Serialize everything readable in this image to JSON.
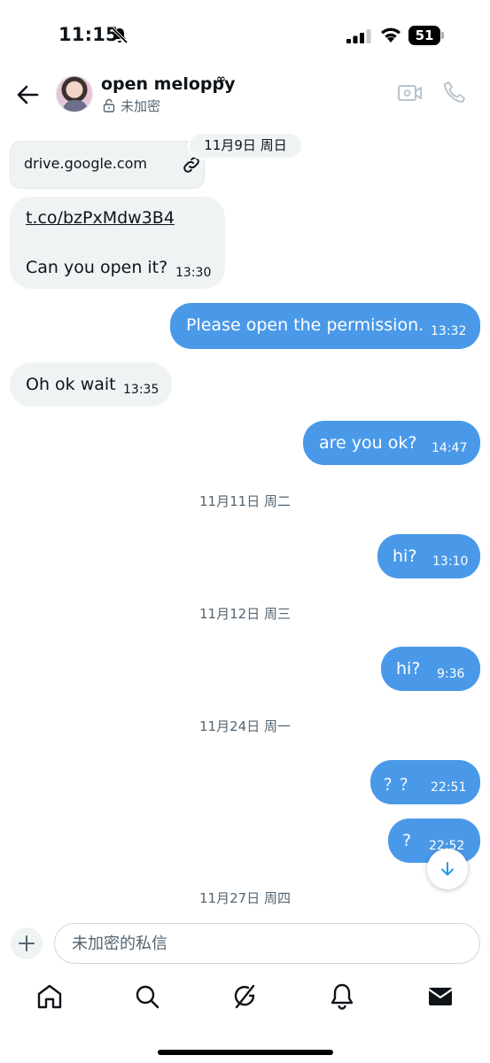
{
  "status_bar": {
    "time": "11:15",
    "battery": "51"
  },
  "header": {
    "contact_name": "open meloppy",
    "name_mark": "∞",
    "encryption_status": "未加密"
  },
  "messages": [
    {
      "type": "link_card",
      "direction": "in",
      "domain": "drive.google.com"
    },
    {
      "type": "text",
      "direction": "in",
      "link_text": "t.co/bzPxMdw3B4",
      "text": "Can you open it?",
      "time": "13:30"
    },
    {
      "type": "text",
      "direction": "out",
      "text": "Please open the permission.",
      "time": "13:32"
    },
    {
      "type": "text",
      "direction": "in",
      "text": "Oh ok wait",
      "time": "13:35"
    },
    {
      "type": "text",
      "direction": "out",
      "text": "are you ok?",
      "time": "14:47"
    },
    {
      "type": "text",
      "direction": "out",
      "text": "hi?",
      "time": "13:10"
    },
    {
      "type": "text",
      "direction": "out",
      "text": "hi?",
      "time": "9:36"
    },
    {
      "type": "text",
      "direction": "out",
      "text": "？？",
      "time": "22:51"
    },
    {
      "type": "text",
      "direction": "out",
      "text": "?",
      "time": "22:52"
    }
  ],
  "date_separators": [
    "11月9日 周日",
    "11月11日 周二",
    "11月12日 周三",
    "11月24日 周一",
    "11月27日 周四"
  ],
  "composer": {
    "placeholder": "未加密的私信"
  },
  "tab_bar": {
    "items": [
      "home-icon",
      "search-icon",
      "grok-icon",
      "notifications-icon",
      "messages-icon"
    ],
    "active": "messages-icon"
  },
  "colors": {
    "outgoing_bubble": "#4a99e9",
    "incoming_bubble": "#eff3f4",
    "secondary_text": "#536471"
  }
}
